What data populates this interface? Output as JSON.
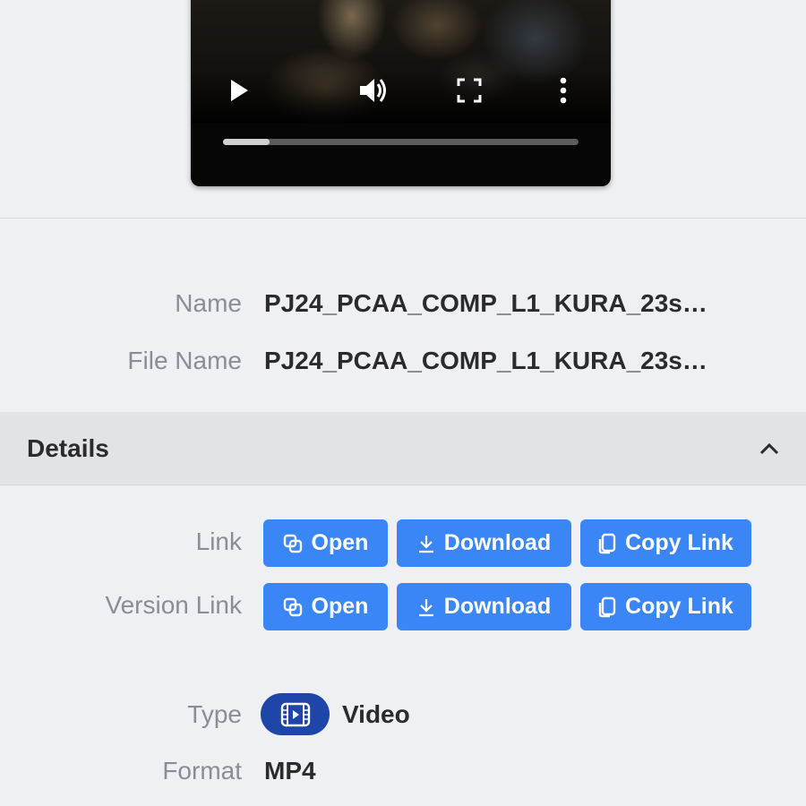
{
  "player": {
    "progress_fraction": 0.13,
    "icons": [
      "play-icon",
      "volume-icon",
      "fullscreen-icon",
      "more-vertical-icon"
    ]
  },
  "info": {
    "name_label": "Name",
    "name_value": "PJ24_PCAA_COMP_L1_KURA_23s…",
    "file_name_label": "File Name",
    "file_name_value": "PJ24_PCAA_COMP_L1_KURA_23s…"
  },
  "details": {
    "title": "Details",
    "toggle_icon": "chevron-up-icon",
    "link_label": "Link",
    "version_link_label": "Version Link",
    "buttons": {
      "open": "Open",
      "download": "Download",
      "copy_link": "Copy Link"
    },
    "type_label": "Type",
    "type_value": "Video",
    "type_icon": "video-file-icon",
    "format_label": "Format",
    "format_value": "MP4"
  },
  "colors": {
    "button_blue": "#3b86f6",
    "type_pill": "#1d46a8",
    "background": "#eef0f3"
  }
}
